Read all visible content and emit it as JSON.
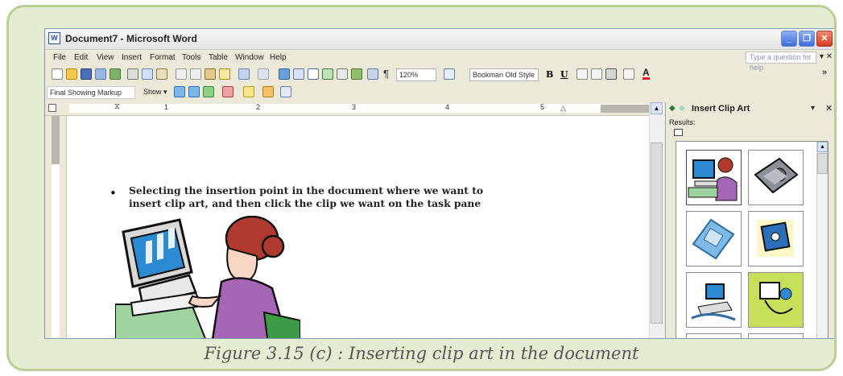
{
  "window": {
    "title": "Document7 - Microsoft Word",
    "app_icon": "W",
    "controls": {
      "minimize": "_",
      "restore": "❐",
      "close": "✕"
    }
  },
  "menubar": {
    "items": [
      "File",
      "Edit",
      "View",
      "Insert",
      "Format",
      "Tools",
      "Table",
      "Window",
      "Help"
    ],
    "help_placeholder": "Type a question for help",
    "close_glyph": "▾ ✕"
  },
  "toolbar": {
    "zoom": "120%",
    "font": "Bookman Old Style",
    "bold": "B",
    "underline": "U",
    "font_color_letter": "A",
    "more": "»"
  },
  "reviewing": {
    "markup": "Final Showing Markup",
    "show": "Show ▾"
  },
  "ruler": {
    "numbers": [
      "1",
      "2",
      "3",
      "4",
      "5"
    ]
  },
  "document": {
    "bullet_text_line1": "Selecting the insertion point in the document where we want to",
    "bullet_text_line2": "insert clip art, and then click the clip we want on the task pane"
  },
  "task_pane": {
    "title": "Insert Clip Art",
    "results_label": "Results:",
    "clips": [
      "computer-user-clip",
      "projector-clip",
      "circuit-chip-clip",
      "disk-clip",
      "computer-network-clip",
      "communication-clip"
    ]
  },
  "caption": "Figure 3.15 (c) : Inserting clip art in the document",
  "colors": {
    "frame_border": "#b9cf95",
    "frame_fill": "#e4edd2",
    "window_chrome": "#ece9d8"
  }
}
